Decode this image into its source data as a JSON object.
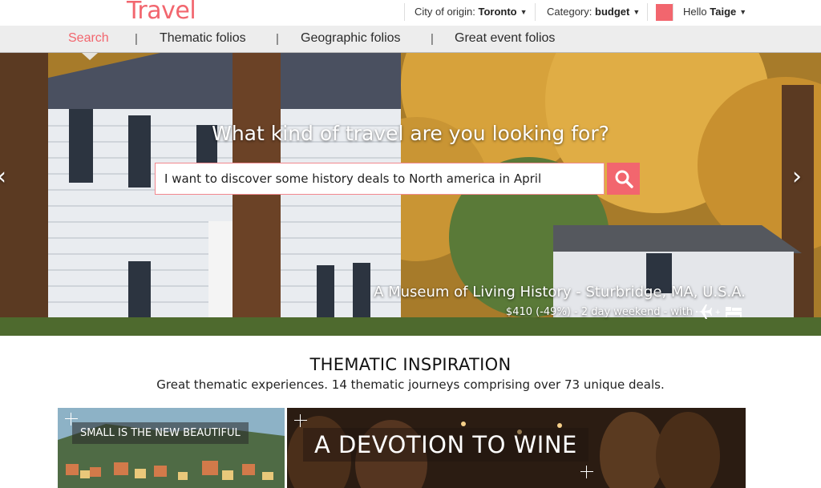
{
  "header": {
    "logo": "Travel",
    "city_label": "City of origin:",
    "city_value": "Toronto",
    "category_label": "Category:",
    "category_value": "budget",
    "greeting_label": "Hello",
    "user_name": "Taige",
    "accent_color": "#f2666e"
  },
  "nav": {
    "items": [
      {
        "label": "Search"
      },
      {
        "label": "Thematic folios"
      },
      {
        "label": "Geographic folios"
      },
      {
        "label": "Great event folios"
      }
    ],
    "divider": "|"
  },
  "hero": {
    "title": "What kind of travel are you looking for?",
    "search_value": "I want to discover some history deals to North america in April",
    "search_icon": "search-icon",
    "prev_arrow": "‹",
    "next_arrow": "›",
    "caption": "A Museum of Living History - Sturbridge, MA, U.S.A.",
    "deal": "$410 (-49%) - 2 day weekend - with",
    "plus": "+",
    "deal_icons": [
      "plane-icon",
      "bed-icon"
    ]
  },
  "section": {
    "title": "THEMATIC INSPIRATION",
    "subtitle": "Great thematic experiences. 14 thematic journeys comprising over 73 unique deals."
  },
  "cards": [
    {
      "label": "SMALL IS THE NEW BEAUTIFUL"
    },
    {
      "label": "A DEVOTION TO WINE"
    }
  ]
}
